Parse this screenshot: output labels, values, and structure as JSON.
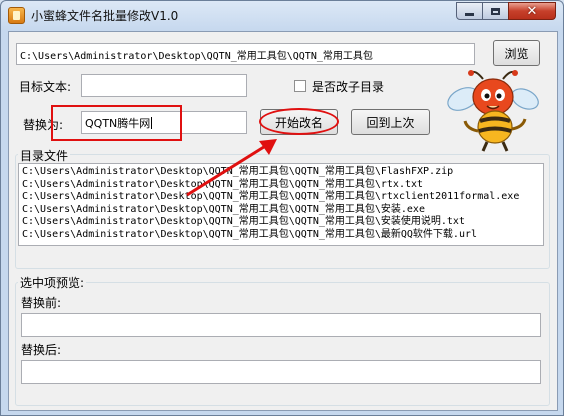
{
  "window": {
    "title": "小蜜蜂文件名批量修改V1.0"
  },
  "path_input": {
    "value": "C:\\Users\\Administrator\\Desktop\\QQTN_常用工具包\\QQTN_常用工具包"
  },
  "browse_button": {
    "label": "浏览"
  },
  "target_text": {
    "label": "目标文本:",
    "value": ""
  },
  "subdir_checkbox": {
    "label": "是否改子目录",
    "checked": false
  },
  "replace_with": {
    "label": "替换为:",
    "value": "QQTN腾牛网"
  },
  "start_rename_button": {
    "label": "开始改名"
  },
  "undo_button": {
    "label": "回到上次"
  },
  "directory_files": {
    "caption": "目录文件",
    "items": [
      "C:\\Users\\Administrator\\Desktop\\QQTN_常用工具包\\QQTN_常用工具包\\FlashFXP.zip",
      "C:\\Users\\Administrator\\Desktop\\QQTN_常用工具包\\QQTN_常用工具包\\rtx.txt",
      "C:\\Users\\Administrator\\Desktop\\QQTN_常用工具包\\QQTN_常用工具包\\rtxclient2011formal.exe",
      "C:\\Users\\Administrator\\Desktop\\QQTN_常用工具包\\QQTN_常用工具包\\安装.exe",
      "C:\\Users\\Administrator\\Desktop\\QQTN_常用工具包\\QQTN_常用工具包\\安装使用说明.txt",
      "C:\\Users\\Administrator\\Desktop\\QQTN_常用工具包\\QQTN_常用工具包\\最新QQ软件下载.url"
    ]
  },
  "preview": {
    "caption": "选中项预览:",
    "before_label": "替换前:",
    "before_value": "",
    "after_label": "替换后:",
    "after_value": ""
  },
  "annotation": {
    "color": "#e01010"
  },
  "icons": {
    "app": "bee-app-icon",
    "mascot": "bee-mascot-icon"
  }
}
